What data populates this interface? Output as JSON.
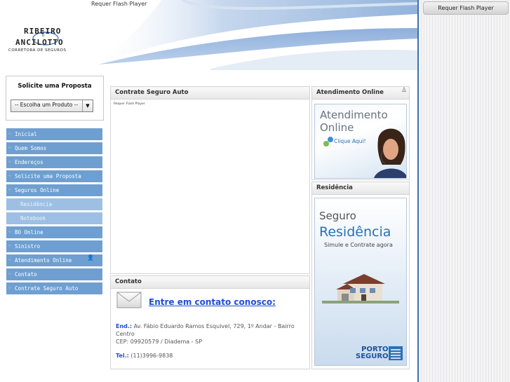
{
  "header": {
    "flash_text": "Requer Flash Player",
    "logo_line1": "RIBEIRO",
    "logo_amp": "E",
    "logo_line2": "ANCILOTTO",
    "logo_line3": "CORRETORA DE SEGUROS"
  },
  "right_panel": {
    "flash_button": "Requer Flash Player"
  },
  "proposal_box": {
    "title": "Solicite uma Proposta",
    "select_value": "-- Escolha um Produto --"
  },
  "menu": {
    "items": [
      {
        "label": "Inicial"
      },
      {
        "label": "Quem Somos"
      },
      {
        "label": "Endereços"
      },
      {
        "label": "Solicite uma Proposta"
      },
      {
        "label": "Seguros Online"
      },
      {
        "label": "Residência"
      },
      {
        "label": "Notebook"
      },
      {
        "label": "BO Online"
      },
      {
        "label": "Sinistro"
      },
      {
        "label": "Atendimento Online"
      },
      {
        "label": "Contato"
      },
      {
        "label": "Contrate Seguro Auto"
      }
    ]
  },
  "panels": {
    "auto": {
      "title": "Contrate Seguro Auto",
      "flash_text": "Requer Flash Player"
    },
    "contato": {
      "title": "Contato",
      "link": "Entre em contato conosco:",
      "end_label": "End.:",
      "end_value": "Av. Fábio Eduardo Ramos Esquivel, 729, 1º Andar - Bairro Centro",
      "cep": "CEP: 09920579 / Diadema - SP",
      "tel_label": "Tel.:",
      "tel_value": "(11)3996-9838"
    },
    "atendimento": {
      "title": "Atendimento Online",
      "img_line1": "Atendimento",
      "img_line2": "Online",
      "img_click": "Clique Aqui!"
    },
    "residencia": {
      "title": "Residência",
      "img_line1": "Seguro",
      "img_line2": "Residência",
      "img_line3": "Simule e Contrate agora",
      "brand1": "PORTO",
      "brand2": "SEGURO"
    }
  }
}
